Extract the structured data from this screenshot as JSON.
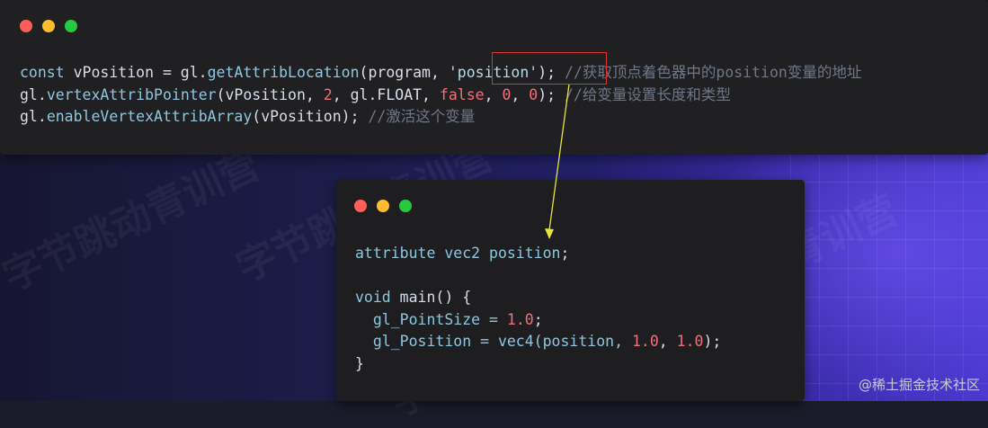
{
  "colors": {
    "dot_red": "#ff5f57",
    "dot_yellow": "#febc2e",
    "dot_green": "#28c840",
    "highlight_border": "#e03030",
    "arrow": "#e6e639"
  },
  "watermark": {
    "text": "字节跳动青训营"
  },
  "top_code": {
    "line1": {
      "kw": "const",
      "var": " vPosition = gl.",
      "fn": "getAttribLocation",
      "args": "(program, ",
      "str": "'position'",
      "end": "); ",
      "comment": "//获取顶点着色器中的position变量的地址"
    },
    "line2": {
      "obj": "gl.",
      "fn": "vertexAttribPointer",
      "a1": "(vPosition, ",
      "n1": "2",
      "a2": ", gl.FLOAT, ",
      "b1": "false",
      "a3": ", ",
      "n2": "0",
      "a4": ", ",
      "n3": "0",
      "end": "); ",
      "comment": "//给变量设置长度和类型"
    },
    "line3": {
      "obj": "gl.",
      "fn": "enableVertexAttribArray",
      "args": "(vPosition); ",
      "comment": "//激活这个变量"
    }
  },
  "shader_code": {
    "line1": {
      "kw": "attribute vec2 position",
      "end": ";"
    },
    "line3": {
      "kw": "void",
      "rest": " main() {"
    },
    "line4": {
      "ind": "  gl_PointSize = ",
      "num": "1.0",
      "end": ";"
    },
    "line5": {
      "ind": "  gl_Position = vec4(position, ",
      "n1": "1.0",
      "sep": ", ",
      "n2": "1.0",
      "end": ");"
    },
    "line6": {
      "text": "}"
    }
  },
  "footer": {
    "text": "@稀土掘金技术社区"
  }
}
